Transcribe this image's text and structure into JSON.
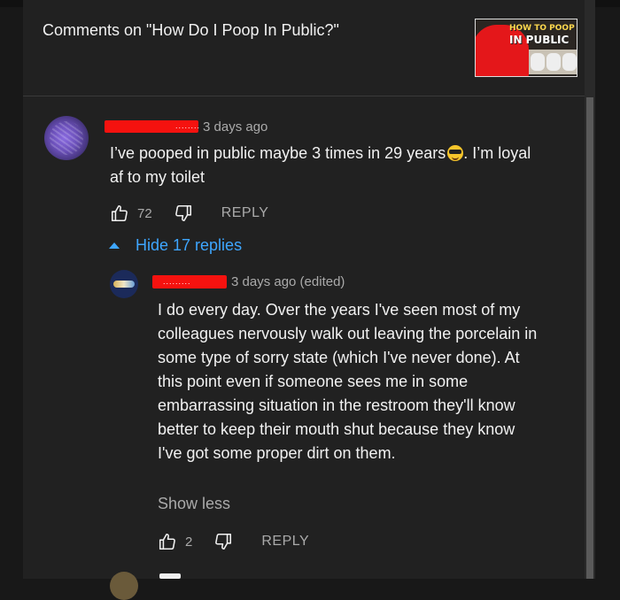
{
  "header": {
    "title": "Comments on \"How Do I Poop In Public?\"",
    "thumbnail_text_line1": "HOW TO POOP",
    "thumbnail_text_line2": "IN PUBLIC"
  },
  "comment": {
    "redact_dots": "........",
    "time": "3 days ago",
    "text_before_emoji": "I’ve pooped in public maybe 3 times in 29 years",
    "emoji": "smiling-face-with-sunglasses",
    "text_after_emoji": ". I’m loyal af to my toilet",
    "likes": "72",
    "reply_label": "REPLY",
    "hide_replies_label": "Hide 17 replies"
  },
  "reply": {
    "redact_dots": ".........",
    "time": "3 days ago (edited)",
    "text": "I do every day. Over the years I've seen most of my colleagues nervously walk out leaving the porcelain in some type of sorry state (which I've never done). At this point even if someone sees me in some embarrassing situation in the restroom they'll know better to keep their mouth shut because they know I've got some proper dirt on them.",
    "show_less_label": "Show less",
    "likes": "2",
    "reply_label": "REPLY"
  },
  "colors": {
    "background": "#212121",
    "link_blue": "#3ea6ff",
    "redaction_red": "#f5120f",
    "secondary_text": "#aaaaaa"
  }
}
